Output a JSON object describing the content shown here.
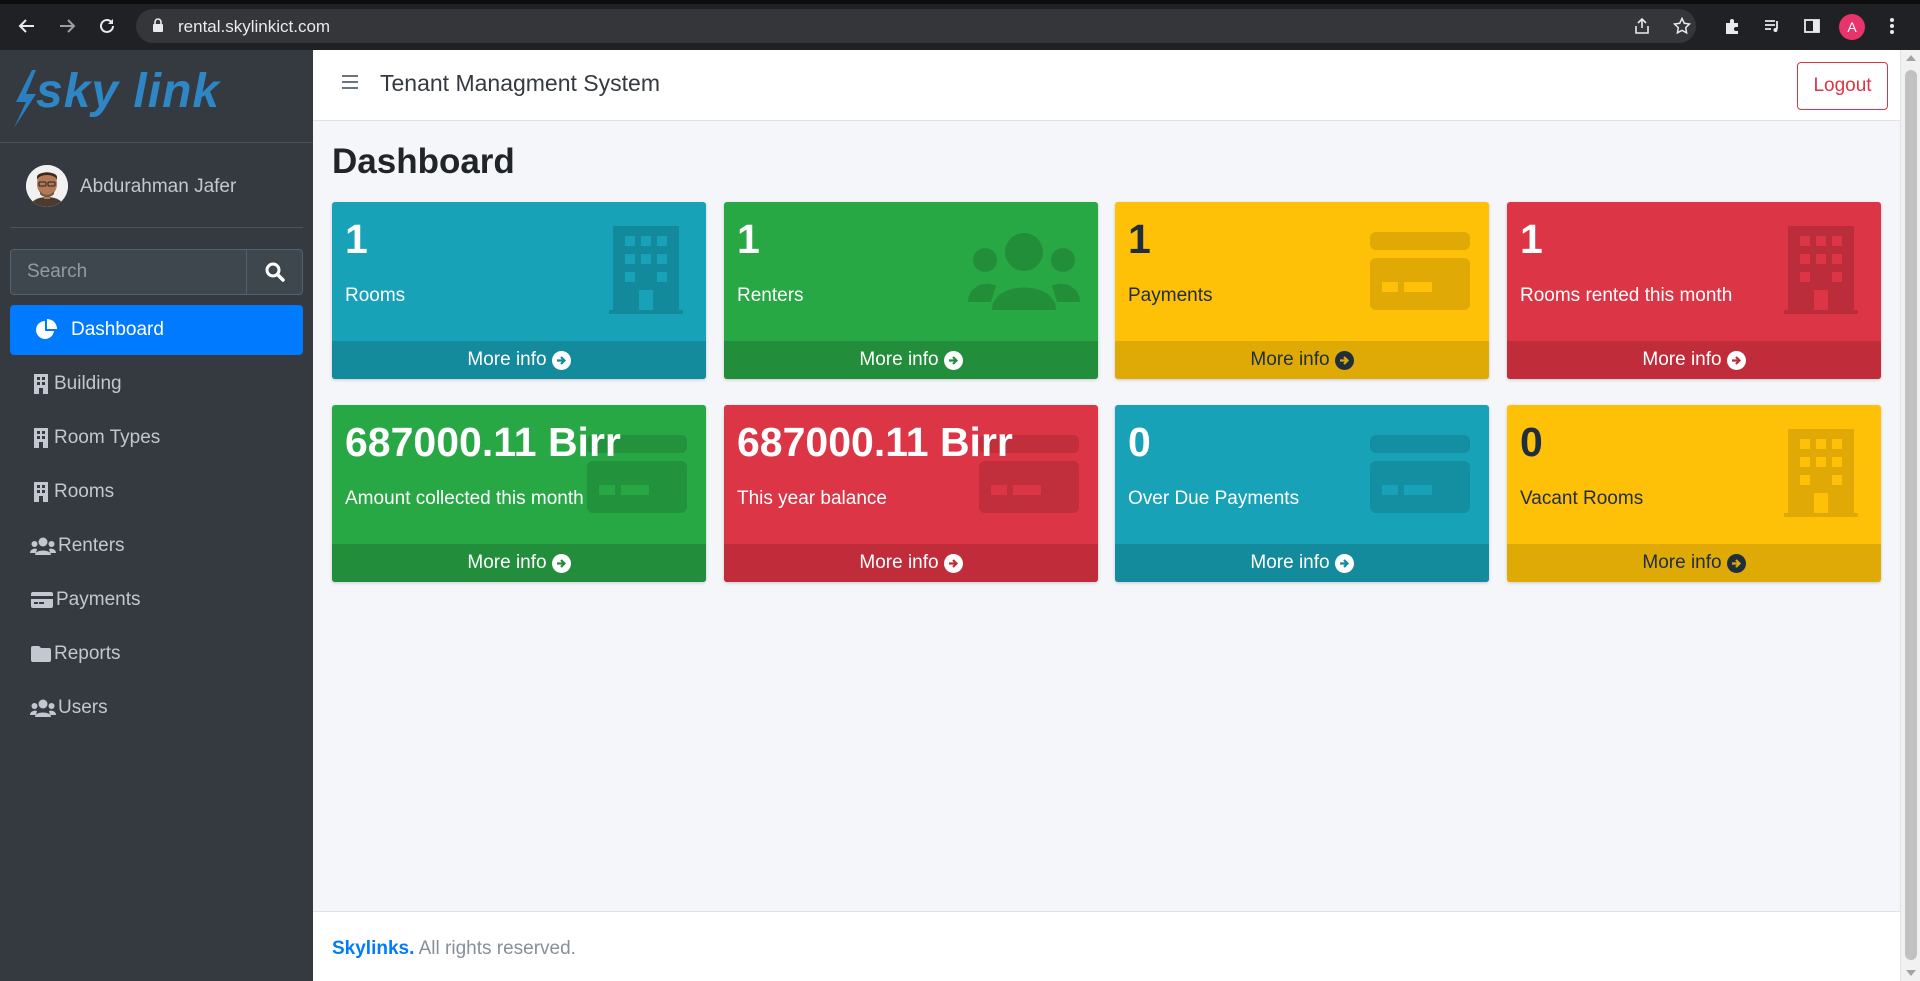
{
  "browser": {
    "url": "rental.skylinkict.com",
    "profile_initial": "A"
  },
  "sidebar": {
    "brand": "sky link",
    "user_name": "Abdurahman Jafer",
    "search_placeholder": "Search",
    "items": [
      {
        "label": "Dashboard",
        "icon": "chart-pie-icon",
        "active": true
      },
      {
        "label": "Building",
        "icon": "building-icon"
      },
      {
        "label": "Room Types",
        "icon": "building-icon"
      },
      {
        "label": "Rooms",
        "icon": "building-icon"
      },
      {
        "label": "Renters",
        "icon": "users-icon"
      },
      {
        "label": "Payments",
        "icon": "credit-card-icon"
      },
      {
        "label": "Reports",
        "icon": "folder-icon"
      },
      {
        "label": "Users",
        "icon": "users-icon"
      }
    ]
  },
  "header": {
    "title": "Tenant Managment System",
    "logout_label": "Logout"
  },
  "main": {
    "page_title": "Dashboard",
    "boxes": [
      {
        "value": "1",
        "label": "Rooms",
        "more": "More info",
        "color": "#17a2b8",
        "icon": "building-icon"
      },
      {
        "value": "1",
        "label": "Renters",
        "more": "More info",
        "color": "#28a745",
        "icon": "users-icon"
      },
      {
        "value": "1",
        "label": "Payments",
        "more": "More info",
        "color": "#ffc107",
        "icon": "credit-card-icon"
      },
      {
        "value": "1",
        "label": "Rooms rented this month",
        "more": "More info",
        "color": "#dc3545",
        "icon": "building-icon"
      },
      {
        "value": "687000.11 Birr",
        "label": "Amount collected this month",
        "more": "More info",
        "color": "#28a745",
        "icon": "credit-card-icon"
      },
      {
        "value": "687000.11 Birr",
        "label": "This year balance",
        "more": "More info",
        "color": "#dc3545",
        "icon": "credit-card-icon"
      },
      {
        "value": "0",
        "label": "Over Due Payments",
        "more": "More info",
        "color": "#17a2b8",
        "icon": "credit-card-icon"
      },
      {
        "value": "0",
        "label": "Vacant Rooms",
        "more": "More info",
        "color": "#ffc107",
        "icon": "building-icon"
      }
    ]
  },
  "footer": {
    "brand": "Skylinks.",
    "text": " All rights reserved."
  }
}
